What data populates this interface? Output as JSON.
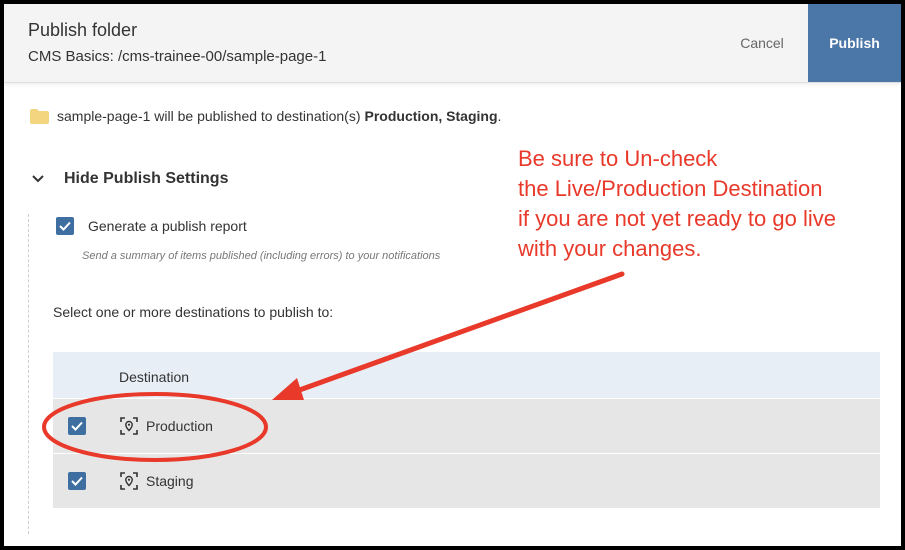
{
  "header": {
    "title": "Publish folder",
    "subtitle": "CMS Basics: /cms-trainee-00/sample-page-1",
    "cancel_label": "Cancel",
    "publish_label": "Publish"
  },
  "info": {
    "folder_name": "sample-page-1",
    "text": "will be published to destination(s)",
    "destinations": "Production, Staging",
    "suffix": "."
  },
  "settings": {
    "toggle_label": "Hide Publish Settings",
    "report_label": "Generate a publish report",
    "report_checked": true,
    "report_hint": "Send a summary of items published (including errors) to your notifications",
    "select_label": "Select one or more destinations to publish to:"
  },
  "table": {
    "header": "Destination",
    "rows": [
      {
        "label": "Production",
        "checked": true
      },
      {
        "label": "Staging",
        "checked": true
      }
    ]
  },
  "annotation": {
    "lines": [
      "Be sure to Un-check",
      "the Live/Production Destination",
      "if you are not yet ready to go live",
      "with your changes."
    ],
    "color": "#e8392a"
  },
  "colors": {
    "accent": "#4a76a8",
    "checkbox": "#3f6fa0",
    "folder": "#f3d57f",
    "table_header": "#e7eef6",
    "table_row": "#e6e6e6"
  },
  "icons": [
    "folder-icon",
    "chevron-down-icon",
    "check-icon",
    "location-target-icon"
  ]
}
